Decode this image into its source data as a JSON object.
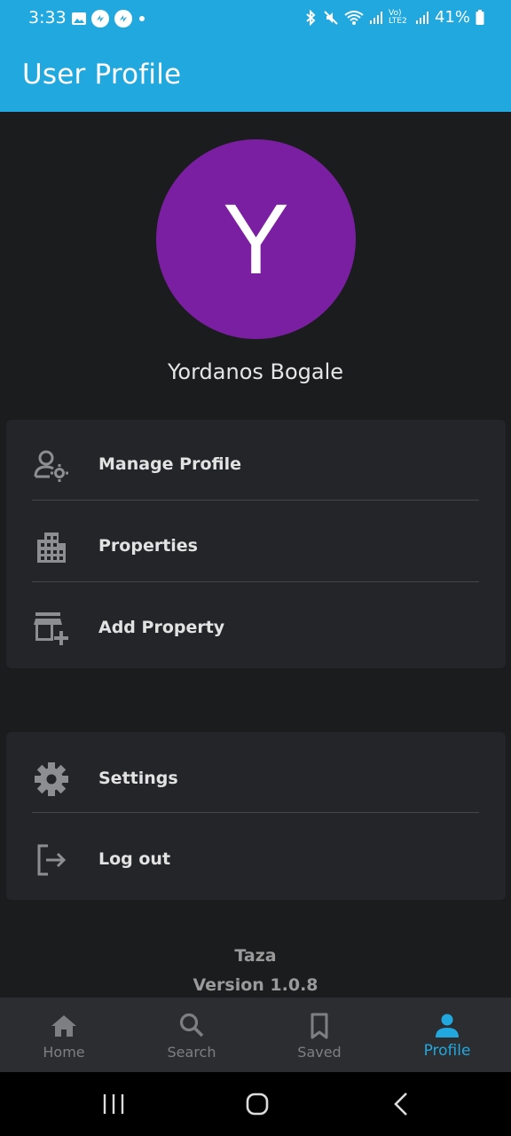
{
  "status_bar": {
    "time": "3:33",
    "battery": "41%",
    "network": "Vo) LTE2"
  },
  "app_bar": {
    "title": "User Profile"
  },
  "profile": {
    "initial": "Y",
    "name": "Yordanos Bogale",
    "avatar_color": "#7b1fa2"
  },
  "menu_primary": [
    {
      "label": "Manage Profile",
      "icon": "manage-profile-icon"
    },
    {
      "label": "Properties",
      "icon": "properties-icon"
    },
    {
      "label": "Add Property",
      "icon": "add-property-icon"
    }
  ],
  "menu_secondary": [
    {
      "label": "Settings",
      "icon": "gear-icon"
    },
    {
      "label": "Log out",
      "icon": "logout-icon"
    }
  ],
  "footer": {
    "app_name": "Taza",
    "version": "Version 1.0.8"
  },
  "bottom_nav": {
    "items": [
      {
        "label": "Home",
        "icon": "home-icon"
      },
      {
        "label": "Search",
        "icon": "search-icon"
      },
      {
        "label": "Saved",
        "icon": "bookmark-icon"
      },
      {
        "label": "Profile",
        "icon": "person-icon"
      }
    ],
    "active": "Profile",
    "active_color": "#21a8df"
  },
  "colors": {
    "accent": "#21a8df",
    "background": "#1b1c1e",
    "card": "#242528"
  }
}
